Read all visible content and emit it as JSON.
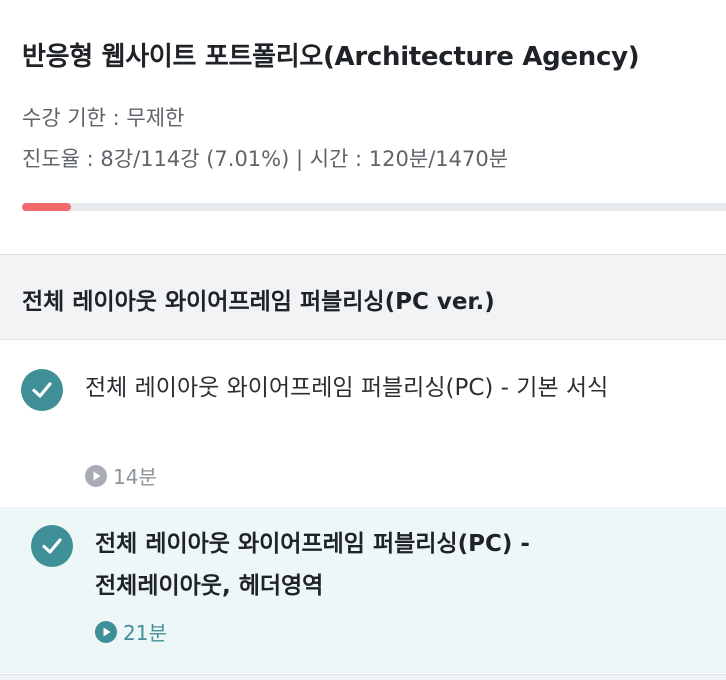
{
  "course": {
    "title": "반응형 웹사이트 포트폴리오(Architecture Agency)",
    "period": "수강 기한 : 무제한",
    "progress_text": "진도율 : 8강/114강 (7.01%) | 시간 : 120분/1470분",
    "progress_percent": 7.01,
    "progress_color": "#f26a6a"
  },
  "section": {
    "title": "전체 레이아웃 와이어프레임 퍼블리싱(PC ver.)"
  },
  "lessons": [
    {
      "title": "전체 레이아웃 와이어프레임 퍼블리싱(PC) - 기본 서식",
      "duration": "14분",
      "completed": true,
      "current": false
    },
    {
      "title": "전체 레이아웃 와이어프레임 퍼블리싱(PC) - 전체레이아웃, 헤더영역",
      "duration": "21분",
      "completed": true,
      "current": true
    }
  ],
  "colors": {
    "accent": "#3f8f96",
    "current_bg": "#edf7f8",
    "section_bg": "#f1f3f5"
  },
  "icons": {
    "check": "check-circle-icon",
    "play": "play-circle-icon"
  }
}
